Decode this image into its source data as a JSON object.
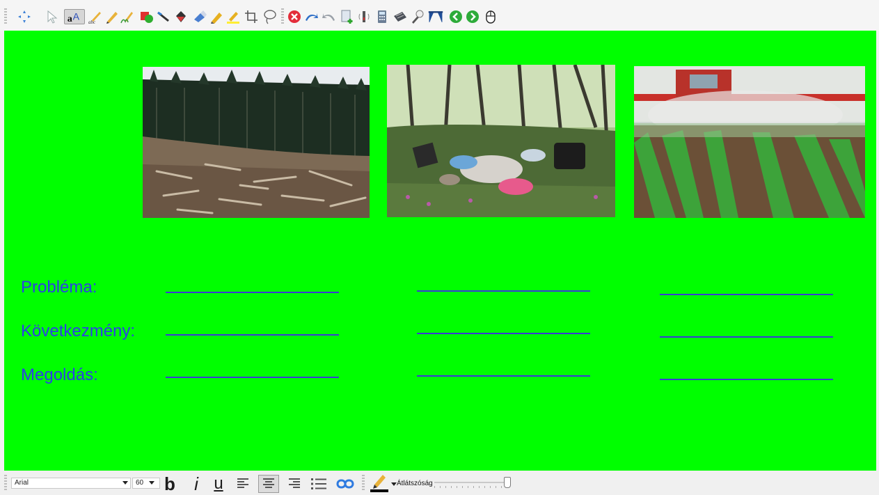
{
  "toolbar": {
    "tools": [
      {
        "id": "fit",
        "label": "fit-to-screen-icon"
      },
      {
        "id": "select",
        "label": "select-arrow-icon"
      },
      {
        "id": "text",
        "label": "text-tool-icon"
      },
      {
        "id": "handwriting",
        "label": "handwriting-pen-icon"
      },
      {
        "id": "recognize",
        "label": "shape-recognition-pen-icon"
      },
      {
        "id": "pen",
        "label": "pen-icon"
      },
      {
        "id": "shapes",
        "label": "shapes-icon"
      },
      {
        "id": "line",
        "label": "line-tool-icon"
      },
      {
        "id": "fill",
        "label": "fill-bucket-icon"
      },
      {
        "id": "eraser",
        "label": "eraser-icon"
      },
      {
        "id": "highlighter",
        "label": "highlighter-icon"
      },
      {
        "id": "highlighter2",
        "label": "highlighter-yellow-icon"
      },
      {
        "id": "crop",
        "label": "crop-icon"
      },
      {
        "id": "lasso",
        "label": "lasso-icon"
      },
      {
        "id": "delete",
        "label": "delete-icon"
      },
      {
        "id": "undo",
        "label": "undo-icon"
      },
      {
        "id": "redo",
        "label": "redo-icon"
      },
      {
        "id": "newpage",
        "label": "new-page-icon"
      },
      {
        "id": "sound",
        "label": "sound-icon"
      },
      {
        "id": "calculator",
        "label": "calculator-icon"
      },
      {
        "id": "keyboard",
        "label": "keyboard-icon"
      },
      {
        "id": "spotlight",
        "label": "spotlight-icon"
      },
      {
        "id": "curtain",
        "label": "curtain-icon"
      },
      {
        "id": "back",
        "label": "back-arrow-icon"
      },
      {
        "id": "forward",
        "label": "forward-arrow-icon"
      },
      {
        "id": "mouse",
        "label": "mouse-icon"
      }
    ],
    "active_tool": "text"
  },
  "canvas": {
    "background": "#00ff00",
    "rows": [
      {
        "label": "Probléma:"
      },
      {
        "label": "Következmény:"
      },
      {
        "label": "Megoldás:"
      }
    ],
    "label_color": "#2c3ee8",
    "line_color": "#3a3ad6",
    "photos": [
      {
        "subject": "clear-cut deforestation"
      },
      {
        "subject": "trash dumped in forest"
      },
      {
        "subject": "tractor spraying pesticide over crops"
      }
    ]
  },
  "format_bar": {
    "font_family": "Arial",
    "font_size": "60",
    "bold_label": "b",
    "italic_label": "i",
    "underline_label": "u",
    "opacity_label": "Átlátszóság",
    "opacity_value": 1.0,
    "pen_color": "#000000"
  }
}
